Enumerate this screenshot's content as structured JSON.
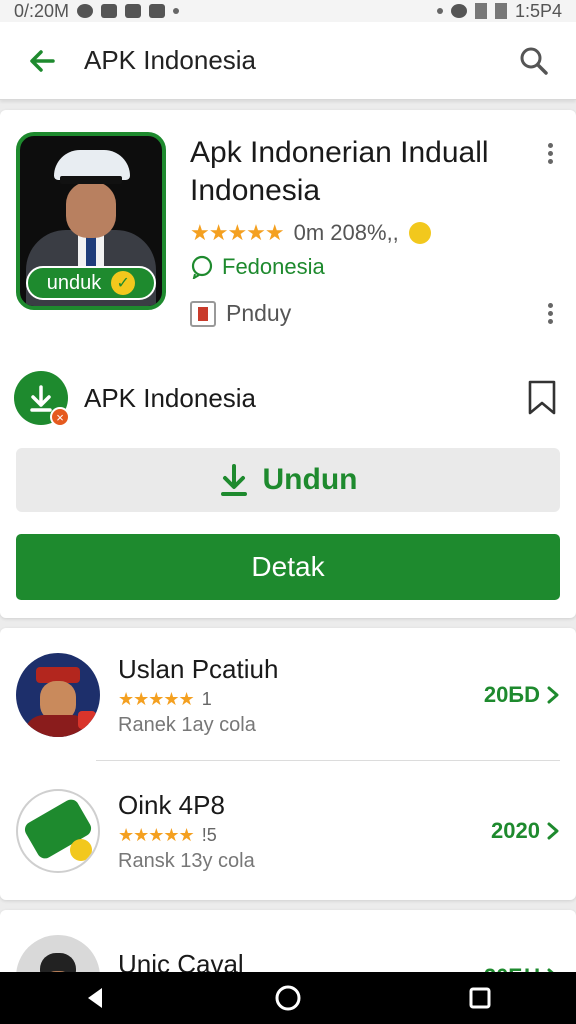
{
  "status_bar": {
    "time_left": "0/:20M",
    "time_right": "1:5P4"
  },
  "app_bar": {
    "title": "APK Indonesia",
    "back_icon": "arrow-left-icon",
    "search_icon": "search-icon"
  },
  "app": {
    "title": "Apk Indonerian Induall Indonesia",
    "badge_label": "unduk",
    "stars": "★★★★★",
    "rating_text": "0m 208%,,",
    "developer": "Fedonesia",
    "category": "Pnduy"
  },
  "source": {
    "name": "APK Indonesia"
  },
  "buttons": {
    "download": "Undun",
    "detail": "Detak"
  },
  "related": [
    {
      "name": "Uslan Pcatiuh",
      "stars": "★★★★★",
      "count": "1",
      "rank": "Ranek 1ay  cola",
      "price": "20БD"
    },
    {
      "name": "Oink 4P8",
      "stars": "★★★★★",
      "count": "!5",
      "rank": "Ransk 13y  cola",
      "price": "2020"
    },
    {
      "name": "Unic Caval",
      "stars": "★★★★★",
      "count": "",
      "rank": "",
      "price": "20БU"
    }
  ],
  "colors": {
    "accent": "#1e8a2e",
    "star": "#f4a020",
    "background": "#ececec"
  }
}
